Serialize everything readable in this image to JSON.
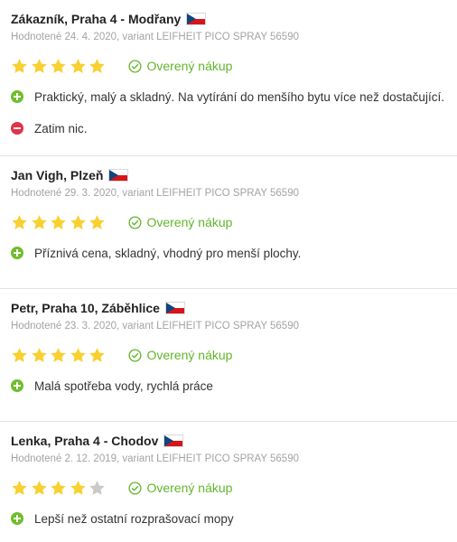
{
  "colors": {
    "star_filled": "#f8d030",
    "star_empty": "#c9c9c9",
    "verified": "#63b52c",
    "plus": "#6fbe2c",
    "minus": "#e0324b"
  },
  "icons": {
    "flag": "czech-flag-icon",
    "verified": "check-circle-icon",
    "pro": "plus-circle-icon",
    "con": "minus-circle-icon",
    "star": "star-icon"
  },
  "reviews": [
    {
      "author": "Zákazník, Praha 4 - Modřany",
      "meta": "Hodnotené 24. 4. 2020, variant LEIFHEIT PICO SPRAY 56590",
      "rating": 5,
      "verified": "Overený nákup",
      "pro": "Praktický, malý a skladný. Na vytírání do menšího bytu více než dostačující.",
      "con": "Zatim nic."
    },
    {
      "author": "Jan Vigh, Plzeň",
      "meta": "Hodnotené 29. 3. 2020, variant LEIFHEIT PICO SPRAY 56590",
      "rating": 5,
      "verified": "Overený nákup",
      "pro": "Příznivá cena, skladný, vhodný pro menší plochy."
    },
    {
      "author": "Petr, Praha 10, Záběhlice",
      "meta": "Hodnotené 23. 3. 2020, variant LEIFHEIT PICO SPRAY 56590",
      "rating": 5,
      "verified": "Overený nákup",
      "pro": "Malá spotřeba vody, rychlá práce"
    },
    {
      "author": "Lenka, Praha 4 - Chodov",
      "meta": "Hodnotené 2. 12. 2019, variant LEIFHEIT PICO SPRAY 56590",
      "rating": 4,
      "verified": "Overený nákup",
      "pro": "Lepší než ostatní rozprašovací mopy"
    }
  ]
}
